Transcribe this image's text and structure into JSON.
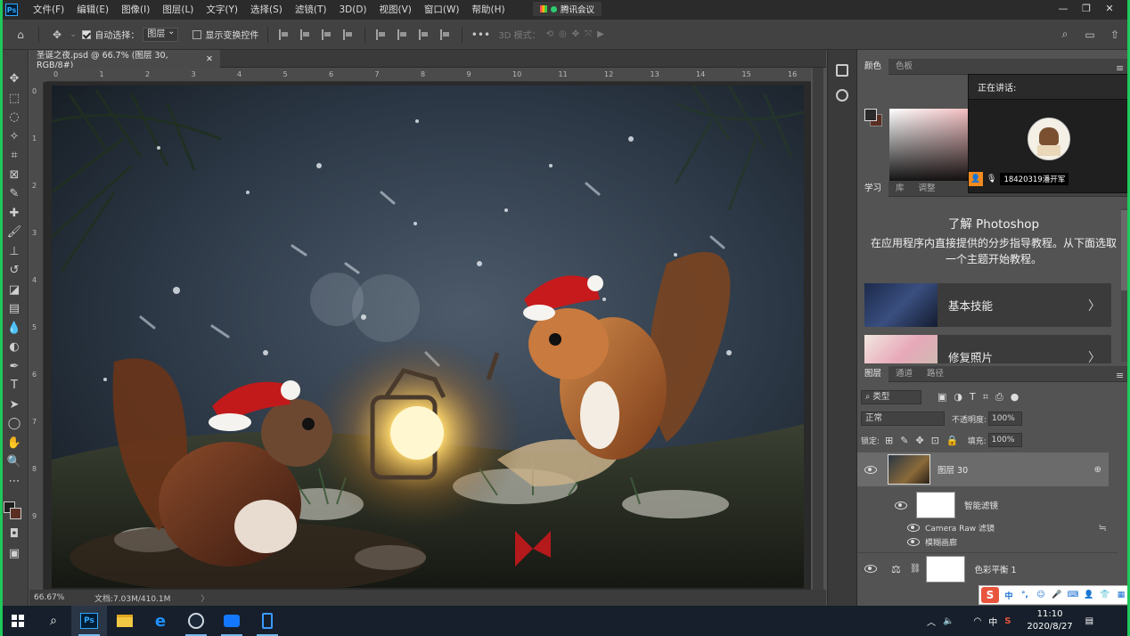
{
  "menubar": {
    "logo": "Ps",
    "items": [
      "文件(F)",
      "编辑(E)",
      "图像(I)",
      "图层(L)",
      "文字(Y)",
      "选择(S)",
      "滤镜(T)",
      "3D(D)",
      "视图(V)",
      "窗口(W)",
      "帮助(H)"
    ],
    "meeting_label": "腾讯会议",
    "window_controls": [
      "minimize",
      "restore",
      "close"
    ]
  },
  "options": {
    "auto_select_label": "自动选择：",
    "auto_select_value": "图层",
    "show_transform_label": "显示变换控件",
    "mode_3d_label": "3D 模式："
  },
  "document": {
    "tab_title": "圣诞之夜.psd @ 66.7% (图层 30, RGB/8#)",
    "zoom": "66.67%",
    "doc_info": "文档:7.03M/410.1M",
    "ruler_h": [
      "0",
      "1",
      "2",
      "3",
      "4",
      "5",
      "6",
      "7",
      "8",
      "9",
      "10",
      "11",
      "12",
      "13",
      "14",
      "15",
      "16"
    ],
    "ruler_v": [
      "0",
      "1",
      "2",
      "3",
      "4",
      "5",
      "6",
      "7",
      "8",
      "9"
    ]
  },
  "color_panel": {
    "tabs": [
      "颜色",
      "色板"
    ],
    "foreground": "#2a2a2a",
    "background": "#5a2e22"
  },
  "learn_panel": {
    "tabs": [
      "学习",
      "库",
      "调整"
    ],
    "title": "了解 Photoshop",
    "description": "在应用程序内直接提供的分步指导教程。从下面选取一个主题开始教程。",
    "cards": [
      {
        "label": "基本技能"
      },
      {
        "label": "修复照片"
      }
    ]
  },
  "meeting_popup": {
    "speaking_label": "正在讲话:",
    "speaker_name": "18420319潘开军"
  },
  "layers_panel": {
    "tabs": [
      "图层",
      "通道",
      "路径"
    ],
    "filter_kind": "类型",
    "blend_mode": "正常",
    "opacity_label": "不透明度:",
    "opacity_value": "100%",
    "lock_label": "锁定:",
    "fill_label": "填充:",
    "fill_value": "100%",
    "layers": [
      {
        "name": "图层 30",
        "type": "smart-object",
        "visible": true,
        "selected": true
      },
      {
        "name": "智能滤镜",
        "type": "smart-filters",
        "visible": true
      },
      {
        "name": "Camera Raw 滤镜",
        "type": "filter",
        "visible": true
      },
      {
        "name": "模糊画廊",
        "type": "filter",
        "visible": true
      },
      {
        "name": "色彩平衡 1",
        "type": "adjustment",
        "visible": true
      }
    ]
  },
  "taskbar": {
    "apps": [
      "start",
      "search",
      "photoshop",
      "file-explorer",
      "edge",
      "steam",
      "tencent-meeting",
      "phone"
    ],
    "time": "11:10",
    "date": "2020/8/27",
    "ime_char": "中",
    "tray_lang": "中",
    "ime_items": [
      "中",
      "°,",
      "☺",
      "🎤",
      "⌨",
      "👤",
      "👕",
      "▦"
    ]
  }
}
